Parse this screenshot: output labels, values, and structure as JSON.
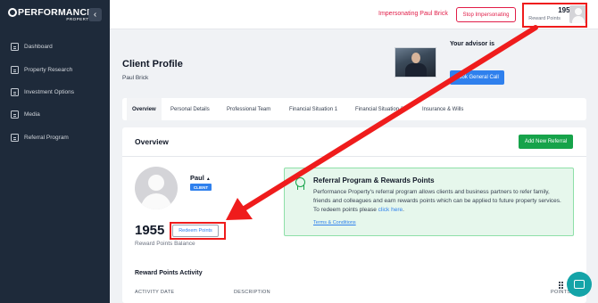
{
  "brand": {
    "name": "PERFORMANCE",
    "sub": "PROPERTY"
  },
  "sidebar": {
    "items": [
      {
        "label": "Dashboard",
        "icon": "dashboard-icon"
      },
      {
        "label": "Property Research",
        "icon": "property-research-icon"
      },
      {
        "label": "Investment Options",
        "icon": "investment-options-icon"
      },
      {
        "label": "Media",
        "icon": "media-icon"
      },
      {
        "label": "Referral Program",
        "icon": "referral-program-icon"
      }
    ]
  },
  "topbar": {
    "impersonating_text": "Impersonating Paul Brick",
    "stop_label": "Stop Impersonating",
    "points": "1955",
    "points_label": "Reward Points"
  },
  "header": {
    "title": "Client Profile",
    "client_name": "Paul Brick",
    "advisor_label": "Your advisor is",
    "book_call_label": "Book General Call"
  },
  "tabs": [
    {
      "label": "Overview",
      "active": true
    },
    {
      "label": "Personal Details"
    },
    {
      "label": "Professional Team"
    },
    {
      "label": "Financial Situation 1"
    },
    {
      "label": "Financial Situation 2"
    },
    {
      "label": "Insurance & Wills"
    }
  ],
  "overview": {
    "title": "Overview",
    "add_referral_label": "Add New Referral",
    "profile": {
      "first_name": "Paul",
      "badge": "CLIENT"
    },
    "points": "1955",
    "redeem_label": "Redeem Points",
    "points_label": "Reward Points Balance",
    "referral": {
      "title": "Referral Program & Rewards Points",
      "body": "Performance Property's referral program allows clients and business partners to refer family, friends and colleagues and earn rewards points which can be applied to future property services. To redeem points please",
      "link": "click here",
      "terms": "Terms & Conditions"
    },
    "activity": {
      "title": "Reward Points Activity",
      "columns": [
        "ACTIVITY DATE",
        "DESCRIPTION",
        "POINTS"
      ]
    }
  },
  "colors": {
    "accent_blue": "#2f80ed",
    "danger": "#e11d48",
    "success": "#16a34a",
    "annotation_red": "#ef1c1c",
    "sidebar": "#1e2a3a"
  }
}
